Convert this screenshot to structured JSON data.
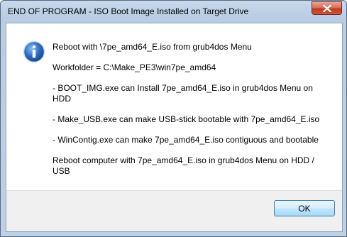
{
  "window": {
    "title": "END OF PROGRAM - ISO Boot Image Installed on Target Drive"
  },
  "icons": {
    "dialog_icon": "information-icon",
    "close_icon": "close-icon"
  },
  "message": {
    "line1": "Reboot with \\7pe_amd64_E.iso from grub4dos Menu",
    "line2": "Workfolder = C:\\Make_PE3\\win7pe_amd64",
    "line3": "- BOOT_IMG.exe can Install 7pe_amd64_E.iso in grub4dos Menu on HDD",
    "line4": "- Make_USB.exe can make USB-stick bootable with 7pe_amd64_E.iso",
    "line5": "- WinContig.exe can make 7pe_amd64_E.iso contiguous and bootable",
    "line6": "Reboot computer with 7pe_amd64_E.iso in grub4dos Menu on HDD / USB"
  },
  "buttons": {
    "ok_label": "OK"
  },
  "colors": {
    "close_button": "#c2391f",
    "info_icon": "#2a63b8",
    "frame": "#bcd0e6"
  }
}
